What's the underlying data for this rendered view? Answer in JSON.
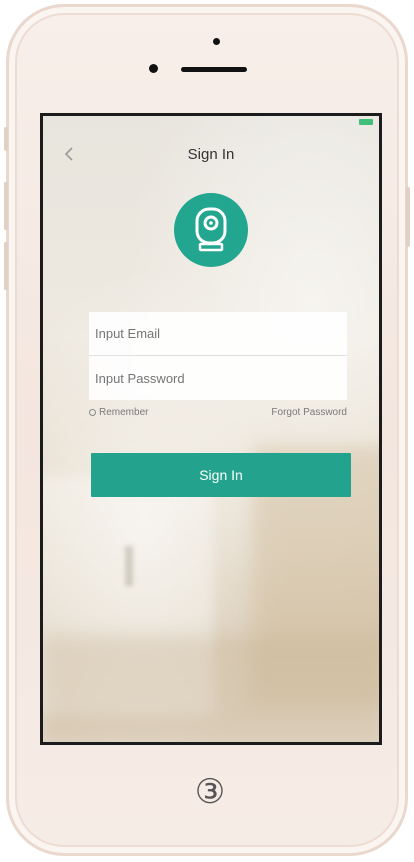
{
  "screen": {
    "title": "Sign In",
    "back_icon": "chevron-left-icon",
    "logo_icon": "camera-icon",
    "email_placeholder": "Input Email",
    "password_placeholder": "Input Password",
    "remember_label": "Remember",
    "forgot_label": "Forgot Password",
    "signin_label": "Sign In"
  },
  "phone": {
    "step_marker": "③"
  },
  "colors": {
    "accent": "#23a38d",
    "logo_bg": "#23a68f",
    "battery": "#3fbf7a"
  }
}
